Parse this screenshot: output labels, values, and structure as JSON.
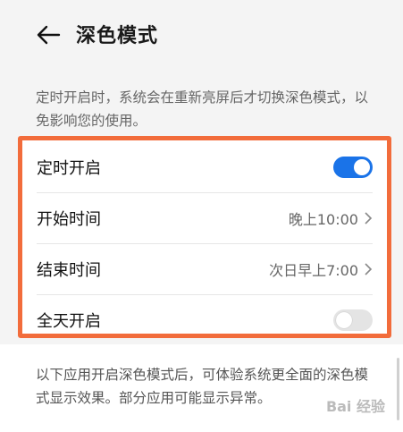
{
  "header": {
    "title": "深色模式",
    "back_icon": "arrow-left-icon"
  },
  "description": "定时开启时，系统会在重新亮屏后才切换深色模式，以免影响您的使用。",
  "settings": [
    {
      "label": "定时开启",
      "type": "toggle",
      "on": true
    },
    {
      "label": "开始时间",
      "type": "value",
      "value": "晚上10:00"
    },
    {
      "label": "结束时间",
      "type": "value",
      "value": "次日早上7:00"
    },
    {
      "label": "全天开启",
      "type": "toggle",
      "on": false
    }
  ],
  "footer_note": "以下应用开启深色模式后，可体验系统更全面的深色模式显示效果。部分应用可能显示异常。",
  "watermark": "Bai 经验",
  "colors": {
    "accent": "#1a73e8",
    "highlight_border": "#f26c3b"
  }
}
